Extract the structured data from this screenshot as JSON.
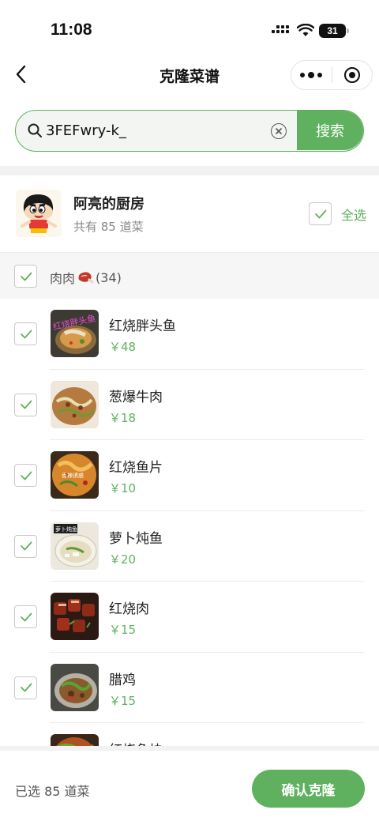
{
  "status_bar": {
    "time": "11:08",
    "battery": "31"
  },
  "nav": {
    "title": "克隆菜谱"
  },
  "search": {
    "value": "3FEFwry-k_",
    "button_label": "搜索"
  },
  "kitchen": {
    "name": "阿亮的厨房",
    "count_text": "共有 85 道菜",
    "select_all_label": "全选",
    "select_all_checked": true
  },
  "category": {
    "label": "肉肉",
    "count": "(34)",
    "icon": "meat-icon",
    "checked": true
  },
  "dishes": [
    {
      "name": "红烧胖头鱼",
      "price": "￥48",
      "checked": true,
      "thumb_text": "红烧胖头鱼"
    },
    {
      "name": "葱爆牛肉",
      "price": "￥18",
      "checked": true
    },
    {
      "name": "红烧鱼片",
      "price": "￥10",
      "checked": true,
      "thumb_text": "香辣诱惑"
    },
    {
      "name": "萝卜炖鱼",
      "price": "￥20",
      "checked": true,
      "thumb_text": "萝卜炖鱼"
    },
    {
      "name": "红烧肉",
      "price": "￥15",
      "checked": true
    },
    {
      "name": "腊鸡",
      "price": "￥15",
      "checked": true
    },
    {
      "name": "红烧鱼块",
      "price": "",
      "checked": true
    }
  ],
  "footer": {
    "selected_text": "已选 85 道菜",
    "confirm_label": "确认克隆"
  },
  "colors": {
    "accent": "#5fb15f",
    "category_bg": "#f6f6f6",
    "price": "#5fb15f"
  }
}
